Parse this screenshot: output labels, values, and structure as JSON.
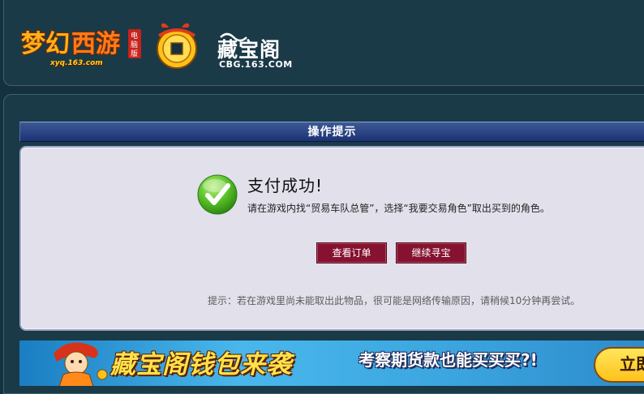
{
  "header": {
    "mhxy_logo": {
      "text": "梦幻西游",
      "edition": "电脑版",
      "domain": "xyq.163.com"
    },
    "cbg_logo": {
      "title": "藏宝阁",
      "domain": "CBG.163.COM"
    }
  },
  "dialog": {
    "title": "操作提示",
    "success_title": "支付成功!",
    "success_desc": "请在游戏内找“贸易车队总管”，选择“我要交易角色”取出买到的角色。",
    "buttons": {
      "view_order": "查看订单",
      "continue": "继续寻宝"
    },
    "tip": "提示：若在游戏里尚未能取出此物品，很可能是网络传输原因，请稍候10分钟再尝试。"
  },
  "banner": {
    "main_text": "藏宝阁钱包来袭",
    "sub_text": "考察期货款也能买买买?!",
    "cta_label": "立即查"
  },
  "colors": {
    "page_bg": "#15313d",
    "frame_bg": "#1a3a47",
    "titlebar": "#1d3274",
    "panel_bg": "#e2e0eb",
    "button_bg": "#86122f",
    "success_green": "#5cc22a",
    "banner_blue": "#49b7ec"
  },
  "icons": {
    "success": "checkmark-circle-icon",
    "cbg_logo": "gold-coin-bag-icon"
  }
}
